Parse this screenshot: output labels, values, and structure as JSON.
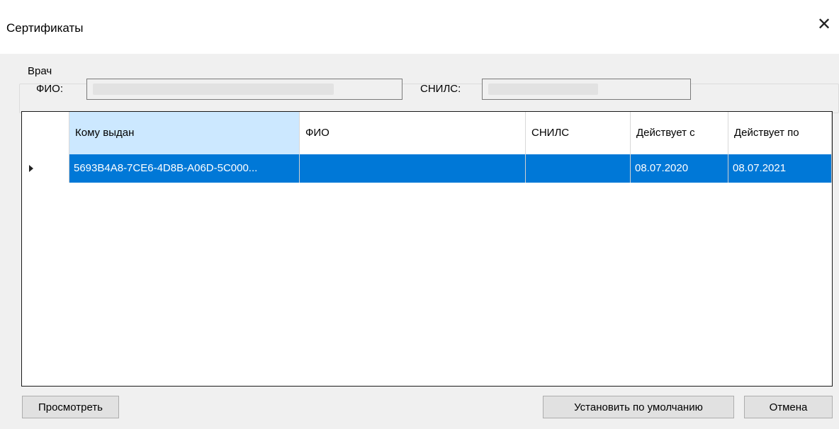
{
  "window": {
    "title": "Сертификаты"
  },
  "doctor": {
    "group_label": "Врач",
    "fio_label": "ФИО:",
    "fio_value": "",
    "snils_label": "СНИЛС:",
    "snils_value": ""
  },
  "table": {
    "columns": [
      "Кому выдан",
      "ФИО",
      "СНИЛС",
      "Действует с",
      "Действует по"
    ],
    "rows": [
      {
        "issued_to": "5693B4A8-7CE6-4D8B-A06D-5C000...",
        "fio": "",
        "snils": "",
        "valid_from": "08.07.2020",
        "valid_to": "08.07.2021"
      }
    ]
  },
  "buttons": {
    "view": "Просмотреть",
    "set_default": "Установить по умолчанию",
    "cancel": "Отмена"
  },
  "colors": {
    "selection": "#0078d7",
    "header_selected": "#cce8ff",
    "background": "#f0f0f0"
  }
}
